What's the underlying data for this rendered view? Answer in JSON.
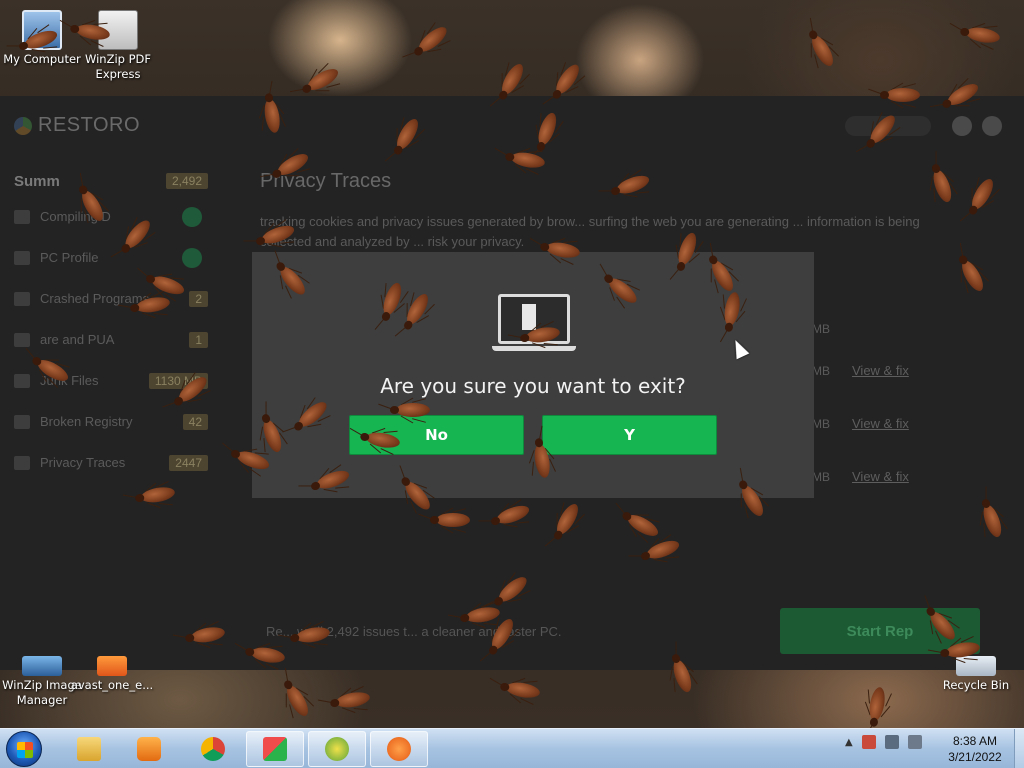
{
  "desktop": {
    "icons_top": [
      {
        "label": "My Computer",
        "icon": "computer-icon"
      },
      {
        "label": "WinZip PDF Express",
        "icon": "pdf-icon"
      }
    ],
    "icons_bottom": [
      {
        "label": "WinZip Image Manager",
        "icon": "winzip-image-icon"
      },
      {
        "label": "avast_one_e...",
        "icon": "avast-icon"
      },
      {
        "label": "Recycle Bin",
        "icon": "recycle-bin-icon"
      }
    ]
  },
  "restoro": {
    "logo": "RESTORO",
    "summary_label": "Summ",
    "summary_count": "2,492",
    "sidebar": [
      {
        "label": "Compiling D",
        "value": ""
      },
      {
        "label": "PC Profile",
        "value": ""
      },
      {
        "label": "Crashed Programs",
        "value": "2"
      },
      {
        "label": "are and PUA",
        "value": "1"
      },
      {
        "label": "Junk Files",
        "value": "1130 MB"
      },
      {
        "label": "Broken Registry",
        "value": "42"
      },
      {
        "label": "Privacy Traces",
        "value": "2447"
      }
    ],
    "main_title": "Privacy Traces",
    "main_desc": "tracking cookies and privacy issues generated by brow... surfing the web you are generating ... information is being collected and analyzed by ... risk your privacy.",
    "rows": [
      {
        "size": "MB",
        "link": ""
      },
      {
        "size": "MB",
        "link": "View & fix"
      },
      {
        "size": "MB",
        "link": "View & fix"
      },
      {
        "size": "MB",
        "link": "View & fix"
      }
    ],
    "footer_text": "Re... w all 2,492 issues t... a cleaner and faster PC.",
    "start_button": "Start Rep"
  },
  "dialog": {
    "question": "Are you sure you want to exit?",
    "no_label": "No",
    "yes_label": "Y"
  },
  "taskbar": {
    "apps": [
      "explorer-icon",
      "media-player-icon",
      "chrome-icon",
      "app-icon",
      "winzip-icon",
      "avast-icon"
    ],
    "time": "8:38 AM",
    "date": "3/21/2022"
  },
  "colors": {
    "dialog_button": "#16b552",
    "dialog_bg": "#3e3e3e",
    "taskbar": "#a7c3e2"
  }
}
